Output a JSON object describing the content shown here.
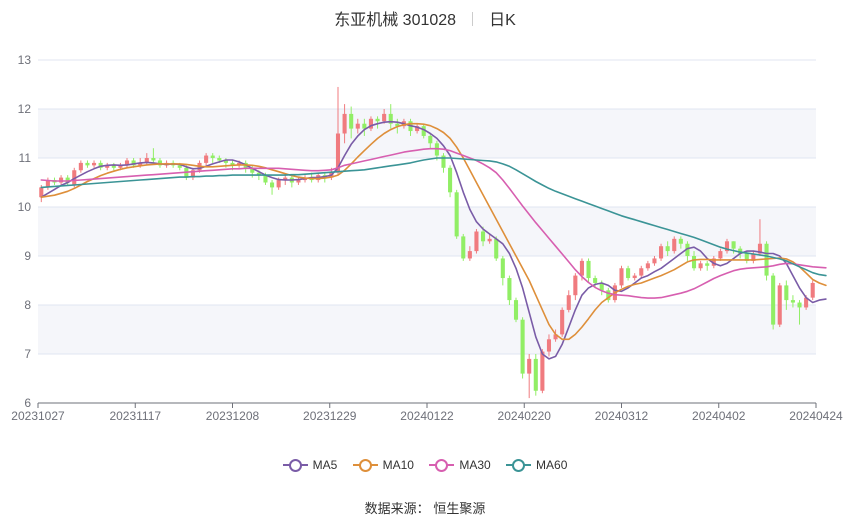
{
  "title": {
    "name": "东亚机械 301028",
    "period": "日K"
  },
  "source": {
    "label": "数据来源：",
    "value": "恒生聚源"
  },
  "colors": {
    "up": "#f07b7f",
    "down": "#91ee65",
    "grid": "#e0e6f1",
    "band": "#f5f6fa",
    "ma5": "#7a5ca7",
    "ma10": "#de8f3a",
    "ma30": "#d75fb0",
    "ma60": "#3b9496"
  },
  "chart_data": {
    "type": "candlestick",
    "xlabel": "",
    "ylabel": "",
    "ylim": [
      6,
      13
    ],
    "yticks": [
      "6",
      "7",
      "8",
      "9",
      "10",
      "11",
      "12",
      "13"
    ],
    "xtick_labels": [
      "20231027",
      "20231117",
      "20231208",
      "20231229",
      "20240122",
      "20240220",
      "20240312",
      "20240402",
      "20240424"
    ],
    "grid": true,
    "legend_position": "bottom",
    "candles": [
      [
        10.2,
        10.4,
        10.1,
        10.45
      ],
      [
        10.4,
        10.55,
        10.35,
        10.6
      ],
      [
        10.55,
        10.5,
        10.45,
        10.6
      ],
      [
        10.5,
        10.6,
        10.45,
        10.65
      ],
      [
        10.6,
        10.5,
        10.45,
        10.65
      ],
      [
        10.45,
        10.75,
        10.4,
        10.8
      ],
      [
        10.75,
        10.9,
        10.7,
        10.95
      ],
      [
        10.9,
        10.85,
        10.8,
        10.95
      ],
      [
        10.85,
        10.9,
        10.8,
        10.95
      ],
      [
        10.9,
        10.8,
        10.75,
        10.95
      ],
      [
        10.8,
        10.85,
        10.75,
        10.9
      ],
      [
        10.85,
        10.8,
        10.75,
        10.9
      ],
      [
        10.8,
        10.85,
        10.75,
        10.9
      ],
      [
        10.85,
        10.95,
        10.8,
        11.0
      ],
      [
        10.95,
        10.85,
        10.8,
        11.0
      ],
      [
        10.85,
        10.9,
        10.8,
        11.0
      ],
      [
        10.9,
        11.0,
        10.85,
        11.1
      ],
      [
        11.0,
        10.95,
        10.9,
        11.2
      ],
      [
        10.95,
        10.85,
        10.8,
        11.0
      ],
      [
        10.85,
        10.9,
        10.8,
        10.95
      ],
      [
        10.9,
        10.85,
        10.8,
        10.95
      ],
      [
        10.85,
        10.8,
        10.75,
        10.9
      ],
      [
        10.8,
        10.6,
        10.55,
        10.85
      ],
      [
        10.6,
        10.75,
        10.55,
        10.8
      ],
      [
        10.75,
        10.9,
        10.7,
        10.95
      ],
      [
        10.9,
        11.05,
        10.85,
        11.1
      ],
      [
        11.05,
        11.0,
        10.9,
        11.1
      ],
      [
        11.0,
        10.95,
        10.9,
        11.05
      ],
      [
        10.95,
        10.9,
        10.8,
        11.0
      ],
      [
        10.9,
        10.85,
        10.75,
        10.95
      ],
      [
        10.85,
        10.9,
        10.8,
        10.95
      ],
      [
        10.9,
        10.8,
        10.7,
        10.95
      ],
      [
        10.8,
        10.7,
        10.6,
        10.85
      ],
      [
        10.7,
        10.65,
        10.55,
        10.75
      ],
      [
        10.65,
        10.5,
        10.45,
        10.7
      ],
      [
        10.5,
        10.4,
        10.25,
        10.55
      ],
      [
        10.4,
        10.55,
        10.35,
        10.6
      ],
      [
        10.55,
        10.6,
        10.45,
        10.65
      ],
      [
        10.6,
        10.5,
        10.4,
        10.65
      ],
      [
        10.5,
        10.55,
        10.45,
        10.6
      ],
      [
        10.55,
        10.6,
        10.5,
        10.65
      ],
      [
        10.6,
        10.55,
        10.5,
        10.7
      ],
      [
        10.55,
        10.65,
        10.5,
        10.7
      ],
      [
        10.65,
        10.6,
        10.5,
        10.7
      ],
      [
        10.6,
        10.7,
        10.55,
        10.8
      ],
      [
        10.7,
        11.5,
        10.65,
        12.45
      ],
      [
        11.5,
        11.9,
        11.3,
        12.1
      ],
      [
        11.9,
        11.6,
        11.4,
        12.05
      ],
      [
        11.6,
        11.7,
        11.5,
        11.8
      ],
      [
        11.7,
        11.6,
        11.45,
        11.8
      ],
      [
        11.6,
        11.8,
        11.55,
        11.85
      ],
      [
        11.8,
        11.75,
        11.6,
        11.85
      ],
      [
        11.75,
        11.9,
        11.7,
        12.0
      ],
      [
        11.9,
        11.7,
        11.6,
        12.1
      ],
      [
        11.7,
        11.65,
        11.5,
        11.8
      ],
      [
        11.65,
        11.75,
        11.6,
        11.8
      ],
      [
        11.75,
        11.55,
        11.45,
        11.8
      ],
      [
        11.55,
        11.65,
        11.5,
        11.7
      ],
      [
        11.65,
        11.45,
        11.4,
        11.7
      ],
      [
        11.45,
        11.3,
        11.2,
        11.5
      ],
      [
        11.3,
        11.05,
        10.95,
        11.35
      ],
      [
        11.05,
        10.8,
        10.7,
        11.1
      ],
      [
        10.8,
        10.3,
        10.2,
        10.85
      ],
      [
        10.3,
        9.4,
        9.35,
        10.35
      ],
      [
        9.4,
        8.95,
        8.9,
        9.45
      ],
      [
        8.95,
        9.1,
        8.9,
        9.2
      ],
      [
        9.1,
        9.5,
        9.05,
        9.55
      ],
      [
        9.5,
        9.3,
        9.2,
        9.6
      ],
      [
        9.3,
        9.35,
        9.25,
        9.45
      ],
      [
        9.35,
        8.95,
        8.9,
        9.4
      ],
      [
        8.95,
        8.55,
        8.4,
        9.0
      ],
      [
        8.55,
        8.1,
        8.0,
        8.6
      ],
      [
        8.1,
        7.7,
        7.65,
        8.15
      ],
      [
        7.7,
        6.6,
        6.5,
        7.75
      ],
      [
        6.6,
        6.9,
        6.1,
        7.0
      ],
      [
        6.9,
        6.25,
        6.15,
        7.0
      ],
      [
        6.25,
        7.05,
        6.2,
        7.1
      ],
      [
        7.05,
        7.3,
        6.95,
        7.4
      ],
      [
        7.3,
        7.4,
        7.25,
        7.5
      ],
      [
        7.4,
        7.9,
        7.35,
        7.95
      ],
      [
        7.9,
        8.2,
        7.85,
        8.3
      ],
      [
        8.2,
        8.6,
        8.1,
        8.65
      ],
      [
        8.6,
        8.9,
        8.5,
        8.95
      ],
      [
        8.9,
        8.55,
        8.45,
        8.95
      ],
      [
        8.55,
        8.45,
        8.35,
        8.6
      ],
      [
        8.45,
        8.3,
        8.2,
        8.5
      ],
      [
        8.3,
        8.1,
        8.05,
        8.35
      ],
      [
        8.1,
        8.4,
        8.05,
        8.45
      ],
      [
        8.4,
        8.75,
        8.35,
        8.8
      ],
      [
        8.75,
        8.55,
        8.5,
        8.8
      ],
      [
        8.55,
        8.6,
        8.5,
        8.65
      ],
      [
        8.6,
        8.75,
        8.55,
        8.8
      ],
      [
        8.75,
        8.85,
        8.7,
        8.9
      ],
      [
        8.85,
        8.95,
        8.8,
        9.0
      ],
      [
        8.95,
        9.2,
        8.9,
        9.25
      ],
      [
        9.2,
        9.1,
        9.0,
        9.3
      ],
      [
        9.1,
        9.35,
        9.05,
        9.4
      ],
      [
        9.35,
        9.25,
        9.15,
        9.4
      ],
      [
        9.25,
        9.0,
        8.9,
        9.3
      ],
      [
        9.0,
        8.75,
        8.7,
        9.1
      ],
      [
        8.75,
        8.85,
        8.7,
        8.9
      ],
      [
        8.85,
        8.8,
        8.7,
        8.9
      ],
      [
        8.8,
        8.95,
        8.75,
        9.0
      ],
      [
        8.95,
        9.1,
        8.9,
        9.15
      ],
      [
        9.1,
        9.3,
        9.05,
        9.35
      ],
      [
        9.3,
        9.15,
        9.05,
        9.3
      ],
      [
        9.15,
        9.05,
        8.95,
        9.2
      ],
      [
        9.05,
        8.9,
        8.85,
        9.1
      ],
      [
        8.9,
        9.05,
        8.85,
        9.1
      ],
      [
        9.05,
        9.25,
        9.0,
        9.75
      ],
      [
        9.25,
        8.6,
        8.5,
        9.3
      ],
      [
        8.6,
        7.6,
        7.5,
        8.65
      ],
      [
        7.6,
        8.4,
        7.55,
        8.45
      ],
      [
        8.4,
        8.1,
        7.9,
        8.5
      ],
      [
        8.1,
        8.05,
        7.95,
        8.2
      ],
      [
        8.05,
        7.95,
        7.6,
        8.1
      ],
      [
        7.95,
        8.15,
        7.9,
        8.2
      ],
      [
        8.15,
        8.45,
        8.1,
        8.5
      ]
    ],
    "series": [
      {
        "name": "MA5",
        "values": [
          10.2,
          10.28,
          10.36,
          10.44,
          10.5,
          10.58,
          10.65,
          10.72,
          10.78,
          10.83,
          10.85,
          10.86,
          10.85,
          10.86,
          10.88,
          10.9,
          10.91,
          10.9,
          10.88,
          10.87,
          10.88,
          10.87,
          10.82,
          10.78,
          10.79,
          10.83,
          10.88,
          10.92,
          10.96,
          10.96,
          10.92,
          10.86,
          10.79,
          10.72,
          10.65,
          10.6,
          10.56,
          10.55,
          10.55,
          10.56,
          10.58,
          10.6,
          10.6,
          10.62,
          10.65,
          10.8,
          11.05,
          11.28,
          11.45,
          11.58,
          11.66,
          11.7,
          11.73,
          11.74,
          11.73,
          11.7,
          11.66,
          11.63,
          11.58,
          11.5,
          11.4,
          11.25,
          11.05,
          10.7,
          10.3,
          9.95,
          9.7,
          9.55,
          9.45,
          9.35,
          9.25,
          9.05,
          8.75,
          8.35,
          7.85,
          7.35,
          7.0,
          6.9,
          6.95,
          7.2,
          7.55,
          7.9,
          8.2,
          8.35,
          8.42,
          8.45,
          8.4,
          8.3,
          8.28,
          8.35,
          8.45,
          8.55,
          8.6,
          8.68,
          8.75,
          8.85,
          8.95,
          9.05,
          9.15,
          9.18,
          9.1,
          8.95,
          8.85,
          8.8,
          8.85,
          8.95,
          9.05,
          9.1,
          9.1,
          9.08,
          9.05,
          9.05,
          9.0,
          8.85,
          8.6,
          8.35,
          8.15,
          8.05,
          8.1,
          8.12
        ]
      },
      {
        "name": "MA10",
        "values": [
          10.2,
          10.22,
          10.24,
          10.28,
          10.32,
          10.38,
          10.45,
          10.52,
          10.58,
          10.64,
          10.69,
          10.73,
          10.77,
          10.8,
          10.82,
          10.84,
          10.86,
          10.87,
          10.88,
          10.88,
          10.88,
          10.88,
          10.87,
          10.85,
          10.83,
          10.82,
          10.82,
          10.83,
          10.84,
          10.85,
          10.86,
          10.86,
          10.85,
          10.83,
          10.8,
          10.76,
          10.72,
          10.68,
          10.64,
          10.61,
          10.59,
          10.58,
          10.58,
          10.59,
          10.61,
          10.65,
          10.75,
          10.88,
          11.02,
          11.15,
          11.28,
          11.4,
          11.5,
          11.58,
          11.64,
          11.68,
          11.7,
          11.7,
          11.69,
          11.66,
          11.6,
          11.52,
          11.4,
          11.22,
          11.0,
          10.75,
          10.5,
          10.25,
          10.0,
          9.75,
          9.5,
          9.25,
          9.0,
          8.75,
          8.5,
          8.2,
          7.9,
          7.6,
          7.4,
          7.3,
          7.3,
          7.4,
          7.55,
          7.72,
          7.9,
          8.05,
          8.15,
          8.25,
          8.32,
          8.38,
          8.42,
          8.45,
          8.5,
          8.55,
          8.6,
          8.66,
          8.72,
          8.8,
          8.88,
          8.92,
          8.93,
          8.93,
          8.92,
          8.92,
          8.92,
          8.92,
          8.92,
          8.92,
          8.92,
          8.93,
          8.94,
          8.95,
          8.96,
          8.94,
          8.88,
          8.78,
          8.65,
          8.52,
          8.45,
          8.4
        ]
      },
      {
        "name": "MA30",
        "values": [
          10.55,
          10.54,
          10.53,
          10.53,
          10.53,
          10.54,
          10.55,
          10.56,
          10.57,
          10.58,
          10.59,
          10.6,
          10.61,
          10.62,
          10.63,
          10.64,
          10.65,
          10.66,
          10.67,
          10.68,
          10.69,
          10.7,
          10.71,
          10.72,
          10.73,
          10.74,
          10.75,
          10.76,
          10.77,
          10.78,
          10.78,
          10.79,
          10.79,
          10.79,
          10.79,
          10.79,
          10.79,
          10.78,
          10.77,
          10.76,
          10.75,
          10.74,
          10.74,
          10.75,
          10.76,
          10.8,
          10.85,
          10.88,
          10.91,
          10.94,
          10.97,
          11.0,
          11.03,
          11.06,
          11.09,
          11.12,
          11.14,
          11.16,
          11.18,
          11.19,
          11.19,
          11.18,
          11.15,
          11.1,
          11.05,
          11.0,
          10.95,
          10.88,
          10.8,
          10.7,
          10.55,
          10.38,
          10.2,
          10.02,
          9.85,
          9.68,
          9.52,
          9.36,
          9.2,
          9.04,
          8.88,
          8.72,
          8.58,
          8.46,
          8.36,
          8.29,
          8.24,
          8.21,
          8.2,
          8.19,
          8.17,
          8.15,
          8.14,
          8.14,
          8.15,
          8.18,
          8.21,
          8.24,
          8.28,
          8.33,
          8.4,
          8.47,
          8.54,
          8.6,
          8.65,
          8.7,
          8.73,
          8.75,
          8.76,
          8.77,
          8.78,
          8.8,
          8.83,
          8.85,
          8.84,
          8.82,
          8.8,
          8.78,
          8.77,
          8.76
        ]
      },
      {
        "name": "MA60",
        "values": [
          10.4,
          10.41,
          10.42,
          10.43,
          10.44,
          10.45,
          10.46,
          10.47,
          10.48,
          10.49,
          10.5,
          10.51,
          10.52,
          10.53,
          10.54,
          10.55,
          10.56,
          10.57,
          10.58,
          10.59,
          10.6,
          10.61,
          10.61,
          10.62,
          10.62,
          10.63,
          10.63,
          10.64,
          10.64,
          10.65,
          10.65,
          10.65,
          10.65,
          10.65,
          10.65,
          10.65,
          10.65,
          10.65,
          10.66,
          10.66,
          10.67,
          10.68,
          10.69,
          10.7,
          10.71,
          10.72,
          10.73,
          10.74,
          10.75,
          10.76,
          10.78,
          10.8,
          10.82,
          10.84,
          10.86,
          10.88,
          10.9,
          10.93,
          10.96,
          10.98,
          11.0,
          11.0,
          11.0,
          10.99,
          10.98,
          10.97,
          10.96,
          10.95,
          10.94,
          10.92,
          10.88,
          10.83,
          10.76,
          10.68,
          10.6,
          10.52,
          10.45,
          10.38,
          10.32,
          10.27,
          10.22,
          10.17,
          10.12,
          10.07,
          10.02,
          9.97,
          9.92,
          9.87,
          9.82,
          9.78,
          9.74,
          9.7,
          9.66,
          9.62,
          9.58,
          9.54,
          9.5,
          9.46,
          9.42,
          9.38,
          9.33,
          9.28,
          9.23,
          9.18,
          9.14,
          9.11,
          9.08,
          9.06,
          9.04,
          9.02,
          9.0,
          8.97,
          8.94,
          8.9,
          8.84,
          8.78,
          8.72,
          8.66,
          8.62,
          8.6
        ]
      }
    ]
  }
}
